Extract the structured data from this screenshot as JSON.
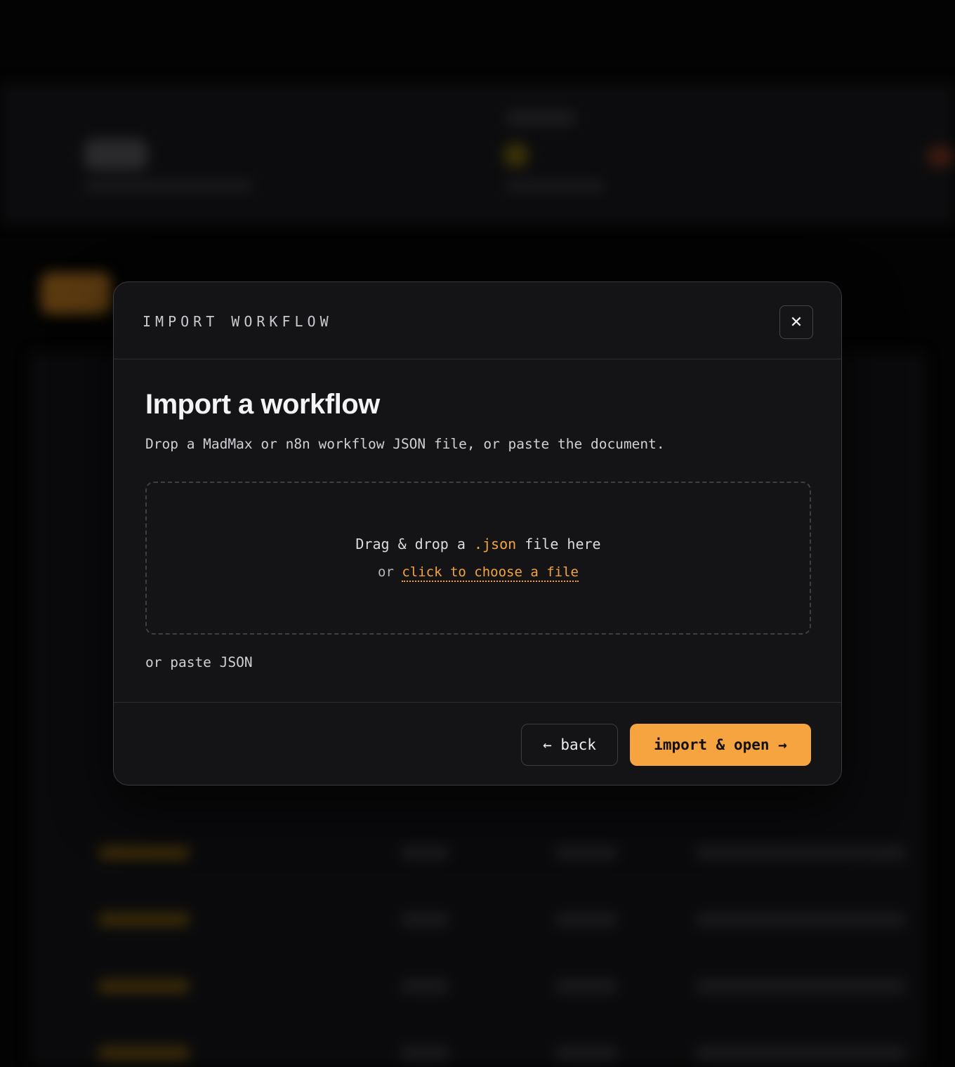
{
  "modal": {
    "eyebrow": "IMPORT WORKFLOW",
    "close_label": "✕",
    "title": "Import a workflow",
    "subtitle": "Drop a MadMax or n8n workflow JSON file, or paste the document.",
    "dropzone": {
      "line1_prefix": "Drag & drop a ",
      "line1_accent": ".json",
      "line1_suffix": " file here",
      "line2_prefix": "or ",
      "line2_link": "click to choose a file"
    },
    "paste_label": "or paste JSON",
    "buttons": {
      "back": "← back",
      "import": "import & open →"
    }
  },
  "colors": {
    "accent": "#f4a43f",
    "modal_bg": "#141417",
    "page_bg": "#030303"
  }
}
